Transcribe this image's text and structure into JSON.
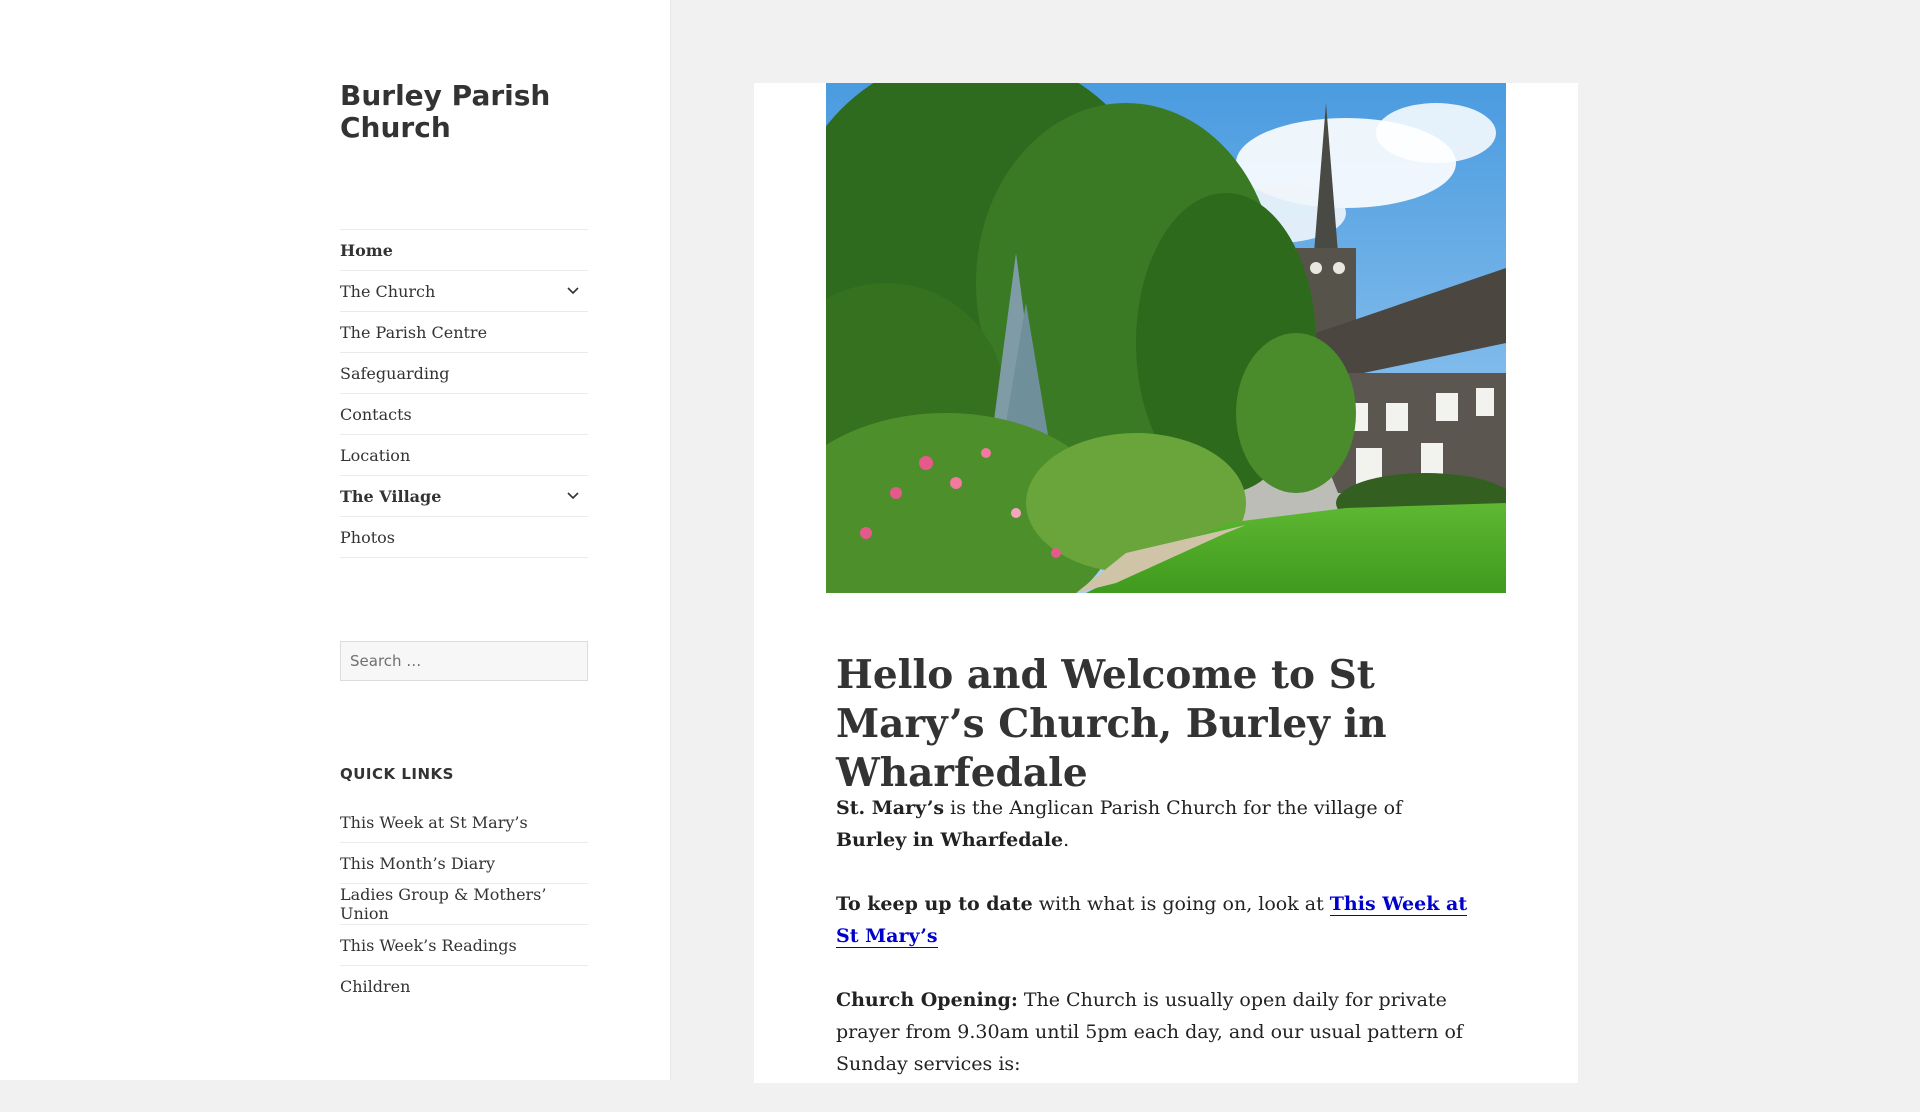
{
  "site": {
    "title": "Burley Parish Church"
  },
  "nav": {
    "items": [
      {
        "label": "Home",
        "bold": true,
        "has_submenu": false
      },
      {
        "label": "The Church",
        "bold": false,
        "has_submenu": true
      },
      {
        "label": "The Parish Centre",
        "bold": false,
        "has_submenu": false
      },
      {
        "label": "Safeguarding",
        "bold": false,
        "has_submenu": false
      },
      {
        "label": "Contacts",
        "bold": false,
        "has_submenu": false
      },
      {
        "label": "Location",
        "bold": false,
        "has_submenu": false
      },
      {
        "label": "The Village",
        "bold": true,
        "has_submenu": true
      },
      {
        "label": "Photos",
        "bold": false,
        "has_submenu": false
      }
    ]
  },
  "search": {
    "placeholder": "Search …"
  },
  "quick_links": {
    "title": "QUICK LINKS",
    "items": [
      "This Week at St Mary’s",
      "This Month’s Diary",
      "Ladies Group & Mothers’ Union",
      "This Week’s Readings",
      "Children"
    ]
  },
  "post": {
    "title": "Hello and Welcome to St Mary’s Church, Burley in Wharfedale",
    "p1": {
      "strong1": "St. Mary’s",
      "text1": " is the Anglican Parish Church for the village of ",
      "strong2": "Burley in Wharfedale",
      "text2": "."
    },
    "p2": {
      "strong": "To keep up to date",
      "text": " with what is going on, look at ",
      "link": "This Week at St Mary’s"
    },
    "p3": {
      "strong": "Church Opening:",
      "text": " The Church is usually open daily for private prayer from 9.30am until 5pm each day, and our usual pattern of Sunday services is:"
    }
  },
  "colors": {
    "link": "#0000cc",
    "text": "#333333",
    "background": "#f1f1f1"
  }
}
